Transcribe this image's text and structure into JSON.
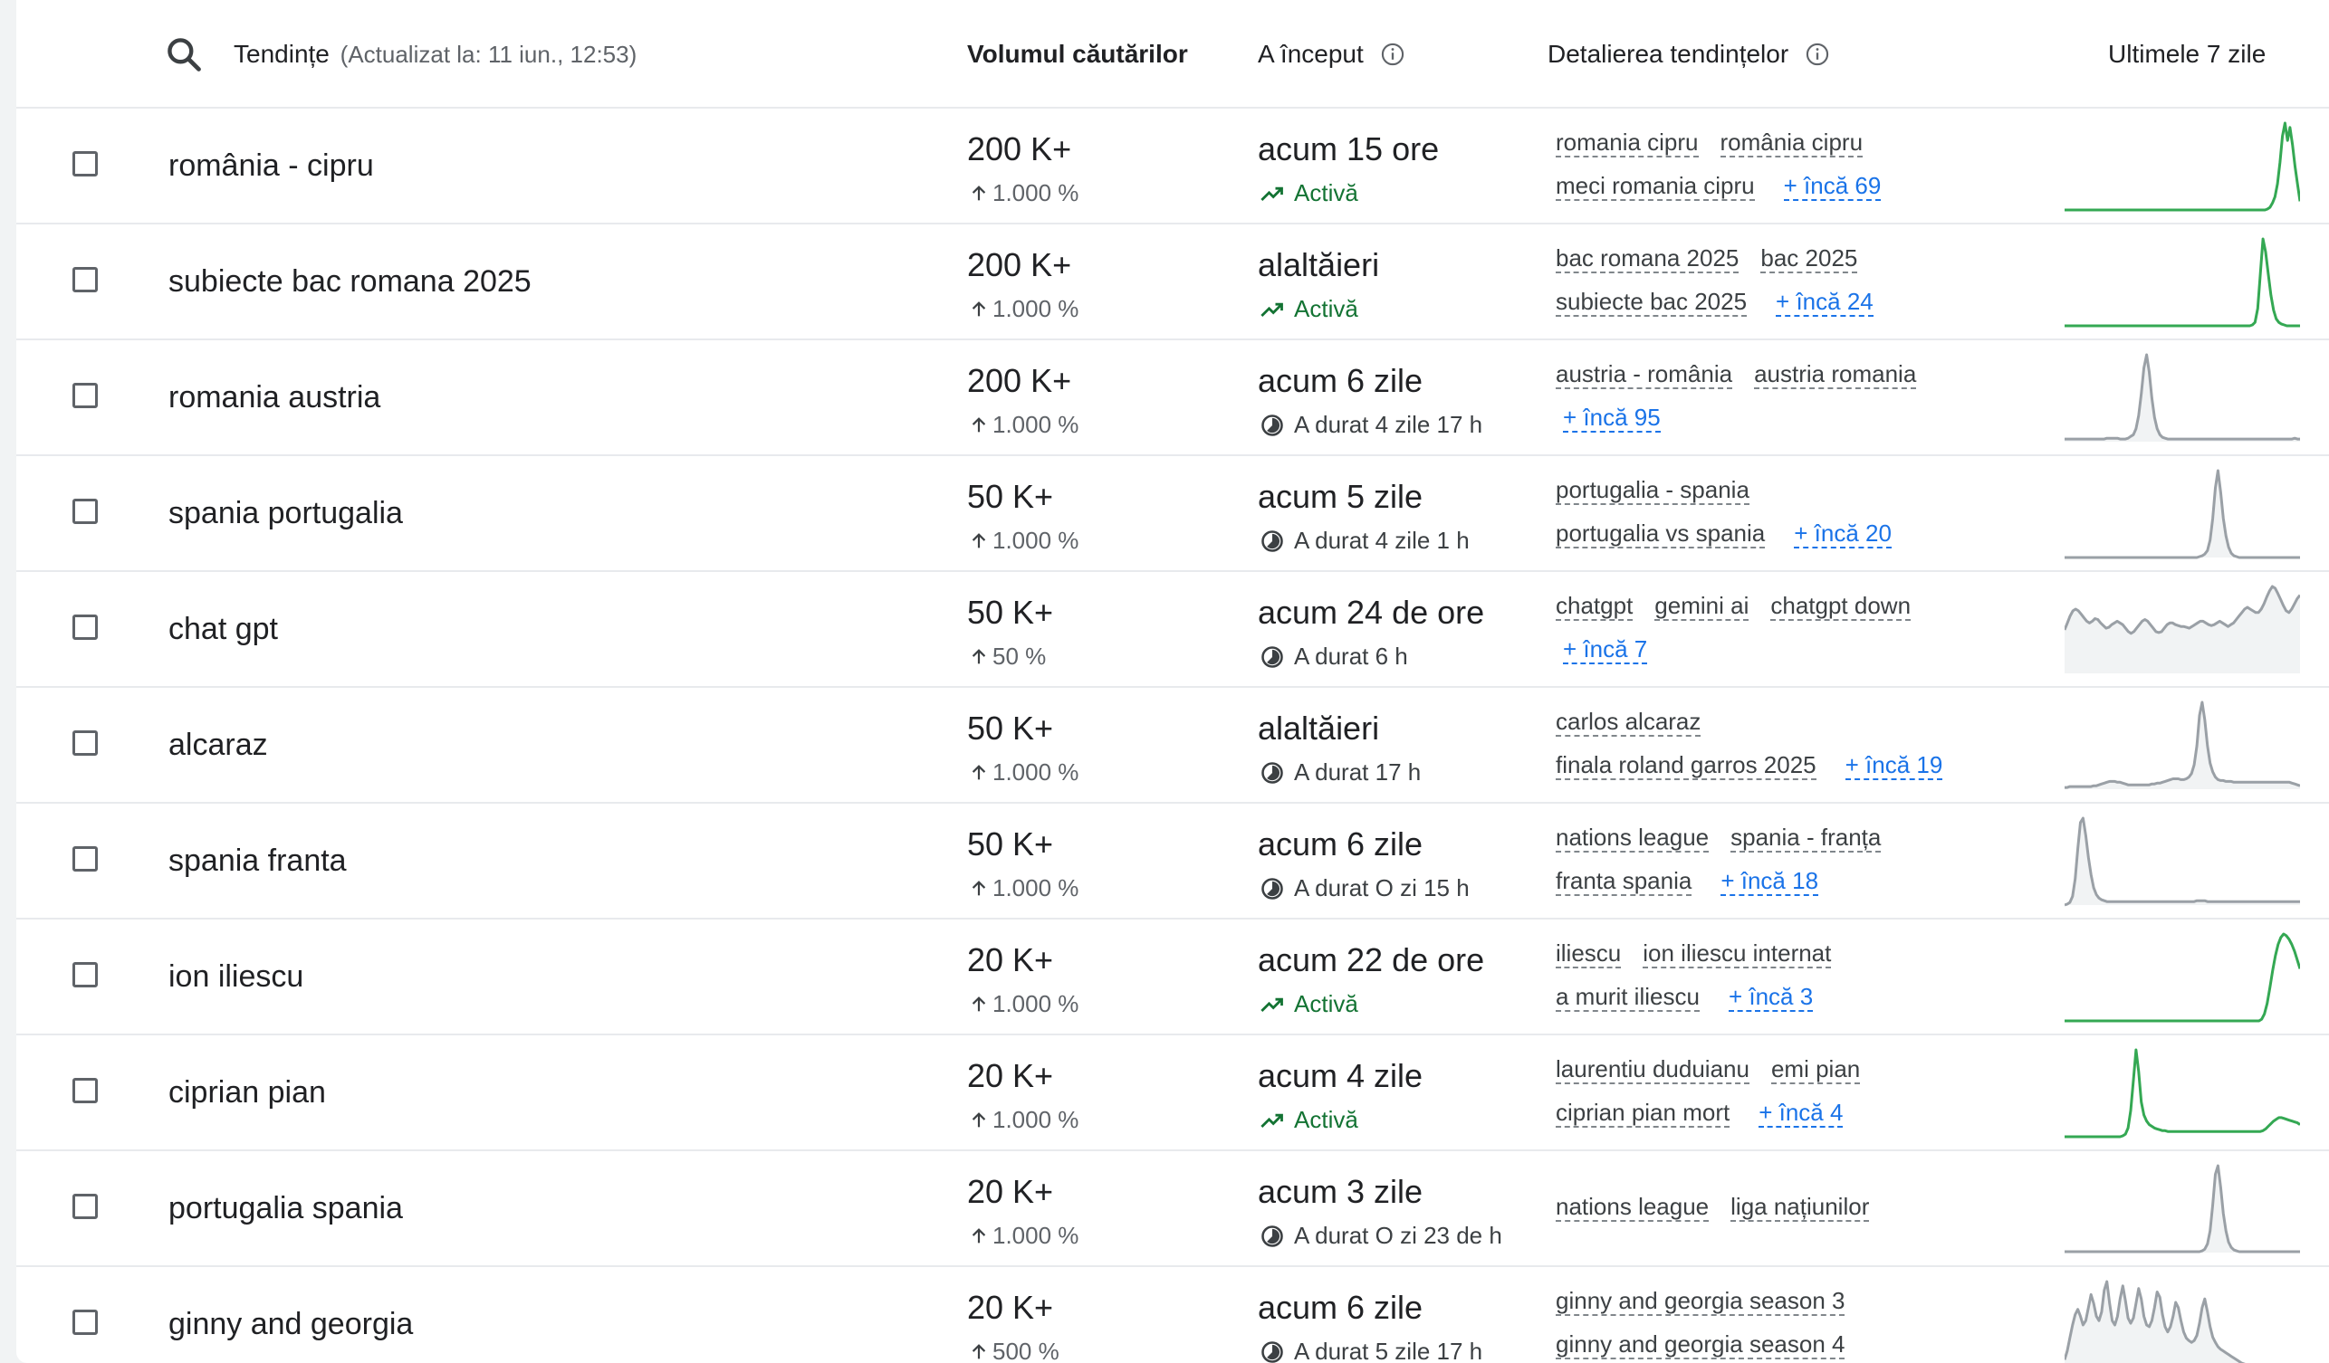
{
  "header": {
    "search_icon": "search-icon",
    "title": "Tendințe",
    "subtitle": "(Actualizat la: 11 iun., 12:53)",
    "col_volume": "Volumul căutărilor",
    "col_started": "A început",
    "col_breakdown": "Detalierea tendințelor",
    "col_last7": "Ultimele 7 zile",
    "info_icon": "info-icon"
  },
  "colors": {
    "active_green": "#137333",
    "spark_green": "#34a853",
    "spark_gray": "#9aa0a6",
    "link_blue": "#1a73e8"
  },
  "rows": [
    {
      "name": "românia - cipru",
      "volume": "200 K+",
      "pct": "1.000 %",
      "started": "acum 15 ore",
      "status": "Activă",
      "active": true,
      "line1": [
        "romania cipru",
        "românia cipru"
      ],
      "line2": [
        "meci romania cipru"
      ],
      "more": "+ încă 69",
      "spark": [
        0,
        0,
        0,
        0,
        0,
        0,
        0,
        0,
        0,
        0,
        0,
        0,
        0,
        0,
        0,
        0,
        0,
        0,
        0,
        0,
        0,
        0,
        0,
        0,
        0,
        0,
        0,
        0,
        0,
        0,
        0,
        0,
        0,
        0,
        0,
        0,
        0,
        0,
        0,
        0,
        0,
        0,
        0,
        0,
        0,
        0,
        0,
        0,
        0,
        0,
        0,
        0,
        0,
        0,
        0,
        0,
        0,
        0,
        0,
        0,
        0,
        0,
        0,
        0,
        0,
        0,
        0,
        0,
        0,
        0,
        0,
        0,
        0,
        0,
        0,
        0,
        0,
        0,
        0,
        0,
        0,
        1,
        3,
        8,
        15,
        30,
        55,
        85,
        100,
        80,
        95,
        75,
        50,
        30,
        10
      ]
    },
    {
      "name": "subiecte bac romana 2025",
      "volume": "200 K+",
      "pct": "1.000 %",
      "started": "alaltăieri",
      "status": "Activă",
      "active": true,
      "line1": [
        "bac romana 2025",
        "bac 2025"
      ],
      "line2": [
        "subiecte bac 2025"
      ],
      "more": "+ încă 24",
      "spark": [
        0,
        0,
        0,
        0,
        0,
        0,
        0,
        0,
        0,
        0,
        0,
        0,
        0,
        0,
        0,
        0,
        0,
        0,
        0,
        0,
        0,
        0,
        0,
        0,
        0,
        0,
        0,
        0,
        0,
        0,
        0,
        0,
        0,
        0,
        0,
        0,
        0,
        0,
        0,
        0,
        0,
        0,
        0,
        0,
        0,
        0,
        0,
        0,
        0,
        0,
        0,
        0,
        0,
        0,
        0,
        0,
        0,
        0,
        0,
        0,
        0,
        0,
        0,
        0,
        0,
        0,
        0,
        0,
        0,
        0,
        0,
        1,
        4,
        20,
        60,
        100,
        85,
        60,
        35,
        18,
        8,
        4,
        2,
        1,
        0,
        0,
        0,
        0,
        0,
        0
      ]
    },
    {
      "name": "romania austria",
      "volume": "200 K+",
      "pct": "1.000 %",
      "started": "acum 6 zile",
      "status": "A durat 4 zile 17 h",
      "active": false,
      "line1": [
        "austria - românia",
        "austria romania"
      ],
      "line2": [],
      "more": "+ încă 95",
      "spark": [
        3,
        3,
        3,
        3,
        3,
        3,
        3,
        3,
        3,
        3,
        3,
        3,
        3,
        3,
        3,
        3,
        4,
        4,
        4,
        4,
        4,
        3,
        3,
        3,
        4,
        6,
        8,
        15,
        30,
        55,
        85,
        100,
        80,
        50,
        28,
        15,
        8,
        5,
        4,
        3,
        3,
        3,
        3,
        3,
        3,
        3,
        3,
        3,
        3,
        3,
        3,
        3,
        3,
        3,
        3,
        3,
        3,
        3,
        3,
        3,
        3,
        3,
        3,
        3,
        3,
        3,
        3,
        3,
        3,
        3,
        3,
        3,
        3,
        3,
        3,
        3,
        3,
        3,
        3,
        3,
        3,
        3,
        3,
        3,
        3,
        3,
        3,
        4,
        3,
        3
      ]
    },
    {
      "name": "spania portugalia",
      "volume": "50 K+",
      "pct": "1.000 %",
      "started": "acum 5 zile",
      "status": "A durat 4 zile 1 h",
      "active": false,
      "line1": [
        "portugalia - spania"
      ],
      "line2": [
        "portugalia vs spania"
      ],
      "more": "+ încă 20",
      "spark": [
        0,
        0,
        0,
        0,
        0,
        0,
        0,
        0,
        0,
        0,
        0,
        0,
        0,
        0,
        0,
        0,
        0,
        0,
        0,
        0,
        0,
        0,
        0,
        0,
        0,
        0,
        0,
        0,
        0,
        0,
        0,
        0,
        0,
        0,
        0,
        0,
        0,
        0,
        0,
        0,
        0,
        0,
        0,
        0,
        0,
        0,
        0,
        0,
        0,
        0,
        0,
        1,
        2,
        4,
        8,
        20,
        45,
        80,
        100,
        75,
        45,
        25,
        12,
        5,
        2,
        1,
        0,
        0,
        0,
        0,
        0,
        0,
        0,
        0,
        0,
        0,
        0,
        0,
        0,
        0,
        0,
        0,
        0,
        0,
        0,
        0,
        0,
        0,
        0,
        0
      ]
    },
    {
      "name": "chat gpt",
      "volume": "50 K+",
      "pct": "50 %",
      "started": "acum 24 de ore",
      "status": "A durat 6 h",
      "active": false,
      "line1": [
        "chatgpt",
        "gemini ai",
        "chatgpt down"
      ],
      "line2": [],
      "more": "+ încă 7",
      "spark": [
        50,
        58,
        66,
        72,
        74,
        72,
        68,
        64,
        60,
        58,
        60,
        63,
        62,
        58,
        55,
        52,
        53,
        56,
        58,
        60,
        58,
        56,
        52,
        48,
        46,
        48,
        52,
        56,
        60,
        62,
        60,
        56,
        52,
        48,
        47,
        48,
        52,
        56,
        58,
        58,
        56,
        55,
        54,
        54,
        53,
        52,
        54,
        56,
        58,
        60,
        60,
        58,
        56,
        55,
        56,
        58,
        60,
        58,
        56,
        54,
        56,
        58,
        62,
        66,
        70,
        74,
        76,
        74,
        72,
        70,
        70,
        74,
        80,
        88,
        95,
        100,
        98,
        92,
        85,
        78,
        72,
        70,
        74,
        80,
        86,
        90
      ]
    },
    {
      "name": "alcaraz",
      "volume": "50 K+",
      "pct": "1.000 %",
      "started": "alaltăieri",
      "status": "A durat 17 h",
      "active": false,
      "line1": [
        "carlos alcaraz"
      ],
      "line2": [
        "finala roland garros 2025"
      ],
      "more": "+ încă 19",
      "spark": [
        2,
        2,
        3,
        3,
        3,
        3,
        3,
        3,
        3,
        3,
        3,
        4,
        4,
        5,
        6,
        7,
        8,
        9,
        9,
        9,
        8,
        8,
        7,
        6,
        5,
        5,
        5,
        5,
        5,
        5,
        5,
        5,
        5,
        6,
        6,
        7,
        7,
        8,
        9,
        10,
        11,
        12,
        12,
        12,
        11,
        11,
        12,
        14,
        18,
        28,
        50,
        85,
        100,
        80,
        50,
        30,
        20,
        14,
        11,
        10,
        10,
        9,
        9,
        9,
        8,
        8,
        8,
        8,
        8,
        8,
        8,
        8,
        8,
        8,
        8,
        8,
        8,
        8,
        8,
        8,
        8,
        8,
        8,
        8,
        8,
        8,
        7,
        6,
        5,
        4
      ]
    },
    {
      "name": "spania franta",
      "volume": "50 K+",
      "pct": "1.000 %",
      "started": "acum 6 zile",
      "status": "A durat O zi 15 h",
      "active": false,
      "line1": [
        "nations league",
        "spania - franța"
      ],
      "line2": [
        "franta spania"
      ],
      "more": "+ încă 18",
      "spark": [
        0,
        1,
        3,
        10,
        30,
        65,
        95,
        100,
        80,
        55,
        35,
        20,
        12,
        8,
        6,
        5,
        4,
        4,
        4,
        4,
        4,
        4,
        4,
        4,
        4,
        4,
        4,
        4,
        4,
        4,
        4,
        4,
        4,
        4,
        4,
        4,
        4,
        4,
        4,
        4,
        4,
        4,
        4,
        4,
        4,
        4,
        4,
        4,
        4,
        4,
        5,
        5,
        5,
        5,
        4,
        4,
        4,
        4,
        4,
        4,
        4,
        4,
        4,
        4,
        4,
        4,
        4,
        4,
        4,
        4,
        4,
        4,
        4,
        4,
        4,
        4,
        4,
        4,
        4,
        4,
        4,
        4,
        4,
        4,
        4,
        4,
        4,
        4,
        4,
        4
      ]
    },
    {
      "name": "ion iliescu",
      "volume": "20 K+",
      "pct": "1.000 %",
      "started": "acum 22 de ore",
      "status": "Activă",
      "active": true,
      "line1": [
        "iliescu",
        "ion iliescu internat"
      ],
      "line2": [
        "a murit iliescu"
      ],
      "more": "+ încă 3",
      "spark": [
        0,
        0,
        0,
        0,
        0,
        0,
        0,
        0,
        0,
        0,
        0,
        0,
        0,
        0,
        0,
        0,
        0,
        0,
        0,
        0,
        0,
        0,
        0,
        0,
        0,
        0,
        0,
        0,
        0,
        0,
        0,
        0,
        0,
        0,
        0,
        0,
        0,
        0,
        0,
        0,
        0,
        0,
        0,
        0,
        0,
        0,
        0,
        0,
        0,
        0,
        0,
        0,
        0,
        0,
        0,
        0,
        0,
        0,
        0,
        0,
        0,
        0,
        0,
        0,
        0,
        0,
        0,
        0,
        0,
        0,
        0,
        0,
        2,
        8,
        20,
        38,
        58,
        75,
        88,
        96,
        100,
        98,
        94,
        88,
        80,
        70,
        60
      ]
    },
    {
      "name": "ciprian pian",
      "volume": "20 K+",
      "pct": "1.000 %",
      "started": "acum 4 zile",
      "status": "Activă",
      "active": true,
      "line1": [
        "laurentiu duduianu",
        "emi pian"
      ],
      "line2": [
        "ciprian pian mort"
      ],
      "more": "+ încă 4",
      "spark": [
        0,
        0,
        0,
        0,
        0,
        0,
        0,
        0,
        0,
        0,
        0,
        0,
        0,
        0,
        0,
        0,
        0,
        0,
        0,
        0,
        0,
        0,
        1,
        3,
        10,
        30,
        65,
        100,
        75,
        40,
        25,
        18,
        14,
        12,
        10,
        9,
        8,
        7,
        7,
        6,
        6,
        6,
        6,
        6,
        6,
        6,
        6,
        6,
        6,
        6,
        6,
        6,
        6,
        6,
        6,
        6,
        6,
        6,
        6,
        6,
        6,
        6,
        6,
        6,
        6,
        6,
        6,
        6,
        6,
        6,
        6,
        6,
        6,
        6,
        6,
        7,
        9,
        12,
        15,
        18,
        20,
        22,
        22,
        21,
        20,
        19,
        18,
        17,
        16,
        14
      ]
    },
    {
      "name": "portugalia spania",
      "volume": "20 K+",
      "pct": "1.000 %",
      "started": "acum 3 zile",
      "status": "A durat O zi 23 de h",
      "active": false,
      "line1": [
        "nations league",
        "liga națiunilor"
      ],
      "line2": [],
      "more": "",
      "spark": [
        1,
        1,
        1,
        1,
        1,
        1,
        1,
        1,
        1,
        1,
        1,
        1,
        1,
        1,
        1,
        1,
        1,
        1,
        1,
        1,
        1,
        1,
        1,
        1,
        1,
        1,
        1,
        1,
        1,
        1,
        1,
        1,
        1,
        1,
        1,
        1,
        1,
        1,
        1,
        1,
        1,
        1,
        1,
        1,
        1,
        1,
        1,
        1,
        1,
        1,
        1,
        1,
        2,
        4,
        10,
        25,
        55,
        90,
        100,
        75,
        45,
        25,
        12,
        6,
        3,
        2,
        1,
        1,
        1,
        1,
        1,
        1,
        1,
        1,
        1,
        1,
        1,
        1,
        1,
        1,
        1,
        1,
        1,
        1,
        1,
        1,
        1,
        1,
        1,
        1
      ]
    },
    {
      "name": "ginny and georgia",
      "volume": "20 K+",
      "pct": "500 %",
      "started": "acum 6 zile",
      "status": "A durat 5 zile 17 h",
      "active": false,
      "line1": [
        "ginny and georgia season 3"
      ],
      "line2": [
        "ginny and georgia season 4"
      ],
      "more": "",
      "spark": [
        10,
        20,
        35,
        50,
        62,
        68,
        60,
        50,
        55,
        70,
        85,
        75,
        60,
        55,
        65,
        90,
        100,
        75,
        55,
        50,
        60,
        80,
        95,
        78,
        58,
        52,
        58,
        75,
        92,
        80,
        60,
        50,
        48,
        55,
        70,
        88,
        82,
        62,
        48,
        42,
        48,
        60,
        76,
        70,
        55,
        42,
        35,
        32,
        30,
        32,
        38,
        52,
        70,
        80,
        65,
        48,
        36,
        30,
        25,
        22,
        20,
        18,
        16,
        14,
        12,
        10,
        8,
        6,
        5,
        4,
        3,
        2,
        2,
        2,
        2,
        2,
        2,
        2,
        2,
        2,
        2,
        2,
        2,
        2,
        2,
        2,
        2,
        2,
        2,
        2
      ]
    }
  ]
}
